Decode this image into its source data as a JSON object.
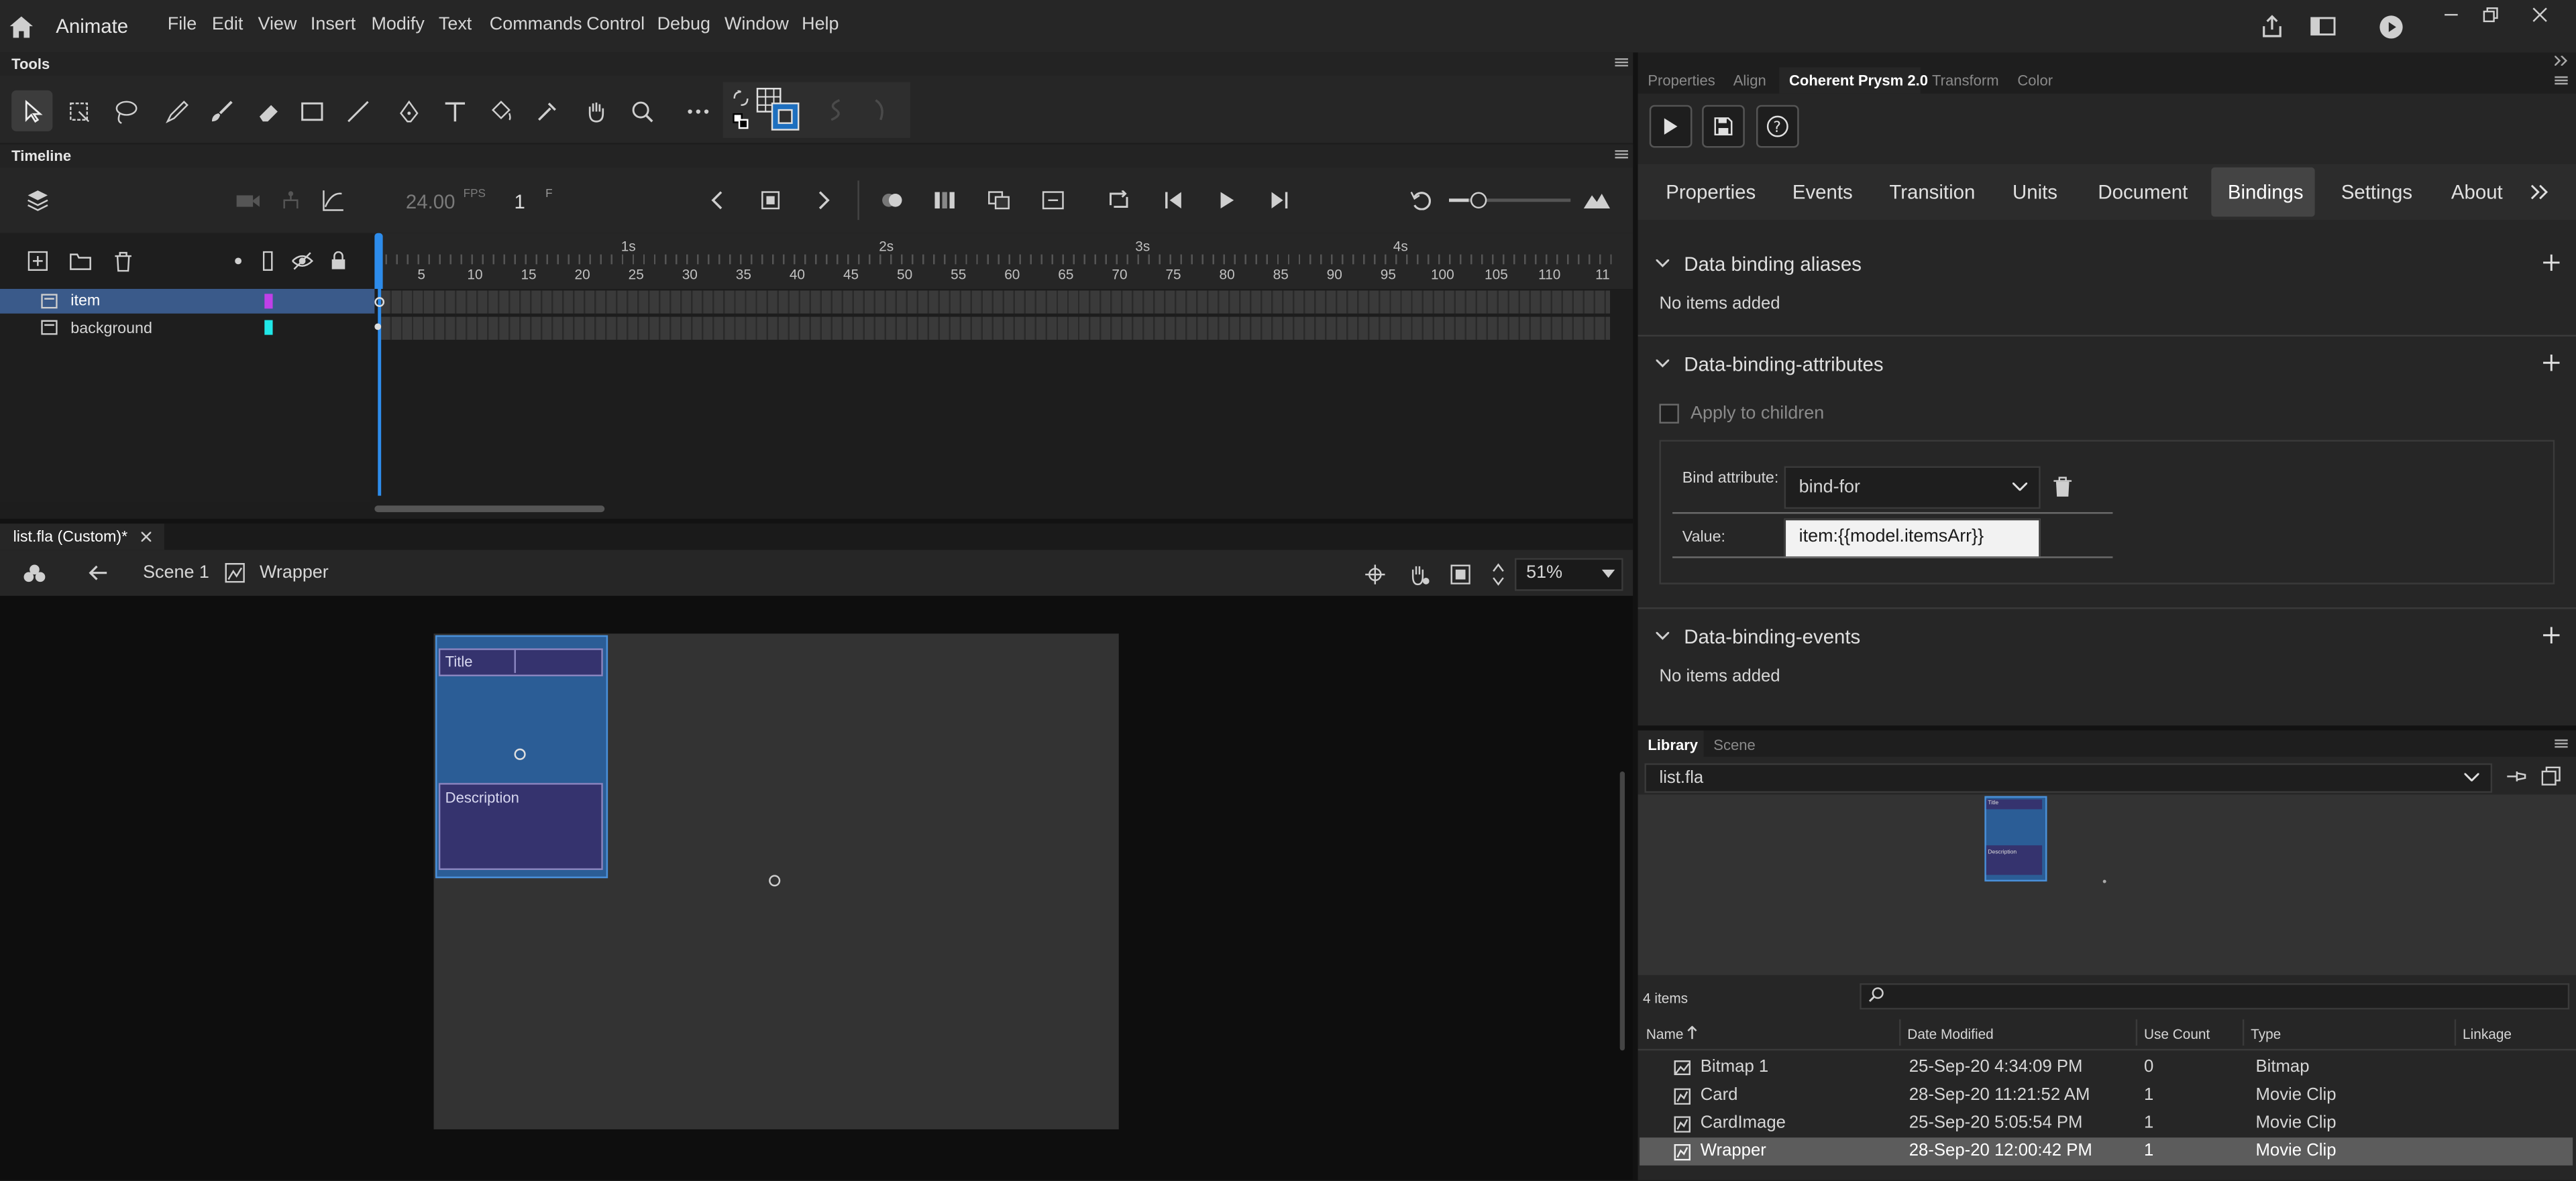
{
  "app": {
    "name": "Animate"
  },
  "menu": [
    "File",
    "Edit",
    "View",
    "Insert",
    "Modify",
    "Text",
    "Commands",
    "Control",
    "Debug",
    "Window",
    "Help"
  ],
  "tools": {
    "title": "Tools"
  },
  "timeline": {
    "title": "Timeline",
    "fps": "24.00",
    "fps_unit": "FPS",
    "frame": "1",
    "frame_unit": "F",
    "seconds": [
      "1s",
      "2s",
      "3s",
      "4s"
    ],
    "frames": [
      "5",
      "10",
      "15",
      "20",
      "25",
      "30",
      "35",
      "40",
      "45",
      "50",
      "55",
      "60",
      "65",
      "70",
      "75",
      "80",
      "85",
      "90",
      "95",
      "100",
      "105",
      "110",
      "11"
    ],
    "layers": [
      {
        "name": "item",
        "color": "#c040e8"
      },
      {
        "name": "background",
        "color": "#20e8e8"
      }
    ]
  },
  "document": {
    "tab": "list.fla (Custom)*",
    "scene": "Scene 1",
    "symbol": "Wrapper",
    "zoom": "51%",
    "card_title": "Title",
    "card_description": "Description"
  },
  "right_tabs": [
    "Properties",
    "Align",
    "Coherent Prysm 2.0",
    "Transform",
    "Color"
  ],
  "prysm": {
    "subtabs": [
      "Properties",
      "Events",
      "Transition",
      "Units",
      "Document",
      "Bindings",
      "Settings",
      "About"
    ],
    "active_subtab": "Bindings",
    "aliases": {
      "title": "Data binding aliases",
      "empty": "No items added"
    },
    "attributes": {
      "title": "Data-binding-attributes",
      "apply_children": "Apply to children",
      "bind_label": "Bind attribute:",
      "bind_value": "bind-for",
      "value_label": "Value:",
      "value": "item:{{model.itemsArr}}"
    },
    "events": {
      "title": "Data-binding-events",
      "empty": "No items added"
    }
  },
  "library": {
    "tabs": [
      "Library",
      "Scene"
    ],
    "file": "list.fla",
    "count": "4 items",
    "columns": [
      "Name",
      "Date Modified",
      "Use Count",
      "Type",
      "Linkage"
    ],
    "items": [
      {
        "name": "Bitmap 1",
        "date": "25-Sep-20 4:34:09 PM",
        "count": "0",
        "type": "Bitmap",
        "icon": "bitmap-icon"
      },
      {
        "name": "Card",
        "date": "28-Sep-20 11:21:52 AM",
        "count": "1",
        "type": "Movie Clip",
        "icon": "movieclip-icon"
      },
      {
        "name": "CardImage",
        "date": "25-Sep-20 5:05:54 PM",
        "count": "1",
        "type": "Movie Clip",
        "icon": "movieclip-icon"
      },
      {
        "name": "Wrapper",
        "date": "28-Sep-20 12:00:42 PM",
        "count": "1",
        "type": "Movie Clip",
        "icon": "movieclip-icon"
      }
    ],
    "thumb_title": "Title",
    "thumb_description": "Description"
  },
  "colors": {
    "accent": "#2d8ceb",
    "selection": "#3a5a8a",
    "card": "#2b5d96",
    "card_inner": "#35336e"
  }
}
